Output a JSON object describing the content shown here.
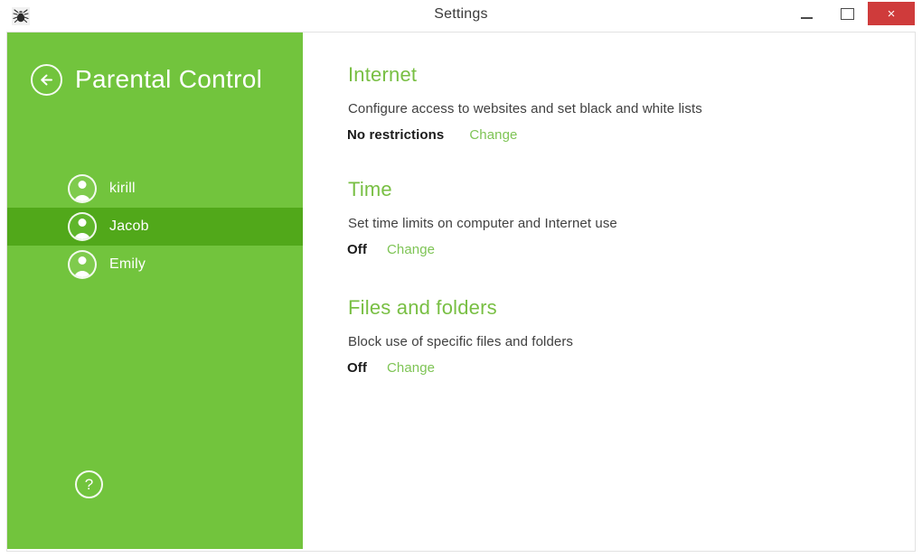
{
  "window": {
    "title": "Settings",
    "app_icon": "spider-logo-icon",
    "controls": {
      "minimize": "minimize-icon",
      "maximize": "maximize-icon",
      "close": "×"
    }
  },
  "sidebar": {
    "back_icon": "back-arrow-icon",
    "title": "Parental Control",
    "help_label": "?",
    "users": [
      {
        "name": "kirill",
        "selected": false
      },
      {
        "name": "Jacob",
        "selected": true
      },
      {
        "name": "Emily",
        "selected": false
      }
    ]
  },
  "content": {
    "sections": [
      {
        "title": "Internet",
        "description": "Configure access to websites and set black and white lists",
        "status": "No restrictions",
        "action": "Change"
      },
      {
        "title": "Time",
        "description": "Set time limits on computer and Internet use",
        "status": "Off",
        "action": "Change"
      },
      {
        "title": "Files and folders",
        "description": "Block use of specific files and folders",
        "status": "Off",
        "action": "Change"
      }
    ]
  },
  "colors": {
    "sidebar_green": "#72c43d",
    "sidebar_selected_green": "#51a81a",
    "heading_green": "#78bf43",
    "link_green": "#7ec455",
    "close_red": "#cf3b3b"
  }
}
